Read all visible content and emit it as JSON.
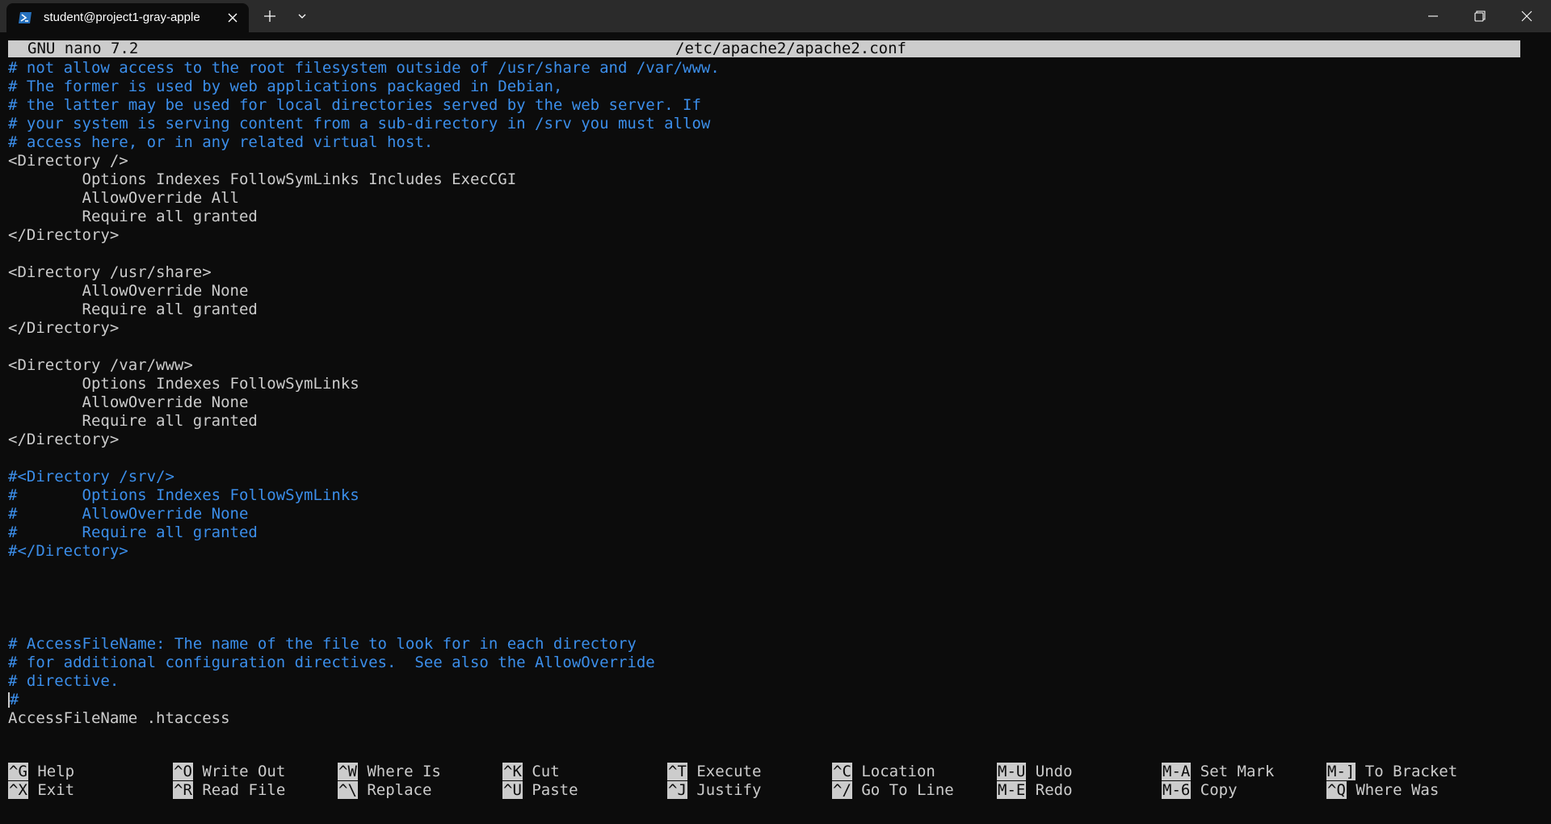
{
  "window": {
    "tab_title": "student@project1-gray-apple",
    "icons": {
      "tab": "powershell-icon",
      "close_tab": "close-icon",
      "new_tab": "plus-icon",
      "dropdown": "chevron-down-icon",
      "minimize": "minimize-icon",
      "maximize": "restore-icon",
      "close_window": "close-icon"
    }
  },
  "nano": {
    "version": "GNU nano 7.2",
    "filename": "/etc/apache2/apache2.conf",
    "lines": [
      {
        "text": "# not allow access to the root filesystem outside of /usr/share and /var/www.",
        "comment": true
      },
      {
        "text": "# The former is used by web applications packaged in Debian,",
        "comment": true
      },
      {
        "text": "# the latter may be used for local directories served by the web server. If",
        "comment": true
      },
      {
        "text": "# your system is serving content from a sub-directory in /srv you must allow",
        "comment": true
      },
      {
        "text": "# access here, or in any related virtual host.",
        "comment": true
      },
      {
        "text": "<Directory />",
        "comment": false
      },
      {
        "text": "        Options Indexes FollowSymLinks Includes ExecCGI",
        "comment": false
      },
      {
        "text": "        AllowOverride All",
        "comment": false
      },
      {
        "text": "        Require all granted",
        "comment": false
      },
      {
        "text": "</Directory>",
        "comment": false
      },
      {
        "text": "",
        "comment": false
      },
      {
        "text": "<Directory /usr/share>",
        "comment": false
      },
      {
        "text": "        AllowOverride None",
        "comment": false
      },
      {
        "text": "        Require all granted",
        "comment": false
      },
      {
        "text": "</Directory>",
        "comment": false
      },
      {
        "text": "",
        "comment": false
      },
      {
        "text": "<Directory /var/www>",
        "comment": false
      },
      {
        "text": "        Options Indexes FollowSymLinks",
        "comment": false
      },
      {
        "text": "        AllowOverride None",
        "comment": false
      },
      {
        "text": "        Require all granted",
        "comment": false
      },
      {
        "text": "</Directory>",
        "comment": false
      },
      {
        "text": "",
        "comment": false
      },
      {
        "text": "#<Directory /srv/>",
        "comment": true
      },
      {
        "text": "#       Options Indexes FollowSymLinks",
        "comment": true
      },
      {
        "text": "#       AllowOverride None",
        "comment": true
      },
      {
        "text": "#       Require all granted",
        "comment": true
      },
      {
        "text": "#</Directory>",
        "comment": true
      },
      {
        "text": "",
        "comment": false
      },
      {
        "text": "",
        "comment": false
      },
      {
        "text": "",
        "comment": false
      },
      {
        "text": "",
        "comment": false
      },
      {
        "text": "# AccessFileName: The name of the file to look for in each directory",
        "comment": true
      },
      {
        "text": "# for additional configuration directives.  See also the AllowOverride",
        "comment": true
      },
      {
        "text": "# directive.",
        "comment": true
      },
      {
        "text": "#",
        "comment": true,
        "cursor": true
      },
      {
        "text": "AccessFileName .htaccess",
        "comment": false
      }
    ],
    "shortcuts": [
      [
        {
          "key": "^G",
          "label": "Help"
        },
        {
          "key": "^O",
          "label": "Write Out"
        },
        {
          "key": "^W",
          "label": "Where Is"
        },
        {
          "key": "^K",
          "label": "Cut"
        },
        {
          "key": "^T",
          "label": "Execute"
        },
        {
          "key": "^C",
          "label": "Location"
        },
        {
          "key": "M-U",
          "label": "Undo"
        },
        {
          "key": "M-A",
          "label": "Set Mark"
        },
        {
          "key": "M-]",
          "label": "To Bracket"
        }
      ],
      [
        {
          "key": "^X",
          "label": "Exit"
        },
        {
          "key": "^R",
          "label": "Read File"
        },
        {
          "key": "^\\",
          "label": "Replace"
        },
        {
          "key": "^U",
          "label": "Paste"
        },
        {
          "key": "^J",
          "label": "Justify"
        },
        {
          "key": "^/",
          "label": "Go To Line"
        },
        {
          "key": "M-E",
          "label": "Redo"
        },
        {
          "key": "M-6",
          "label": "Copy"
        },
        {
          "key": "^Q",
          "label": "Where Was"
        }
      ]
    ]
  },
  "colors": {
    "terminal_bg": "#0c0c0c",
    "text": "#cccccc",
    "comment": "#3b8eea",
    "titlebar_bg": "#2b2b2b"
  }
}
